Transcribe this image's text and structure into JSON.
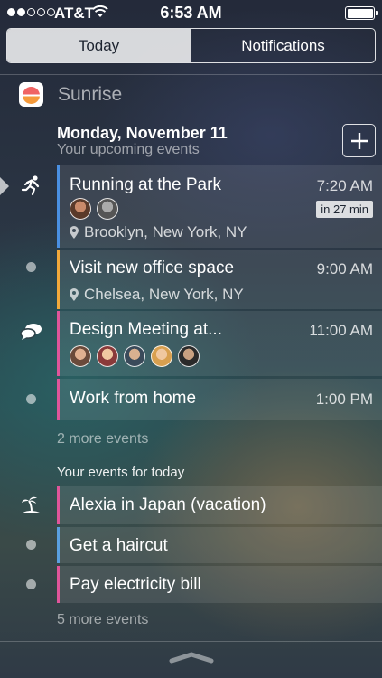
{
  "status_bar": {
    "carrier": "AT&T",
    "time": "6:53 AM",
    "signal_bars": 2
  },
  "tabs": [
    {
      "label": "Today",
      "active": true
    },
    {
      "label": "Notifications",
      "active": false
    }
  ],
  "app": {
    "name": "Sunrise"
  },
  "upcoming": {
    "date_title": "Monday, November 11",
    "subtitle": "Your upcoming events",
    "events": [
      {
        "title": "Running at the Park",
        "time": "7:20 AM",
        "badge": "in 27 min",
        "location": "Brooklyn, New York, NY",
        "color": "#4a90e2",
        "icon": "running-icon",
        "attendees": 2
      },
      {
        "title": "Visit new office space",
        "time": "9:00 AM",
        "location": "Chelsea, New York, NY",
        "color": "#f2a93b",
        "icon": "dot"
      },
      {
        "title": "Design Meeting at...",
        "time": "11:00 AM",
        "color": "#e0559a",
        "icon": "chat-bubbles-icon",
        "attendees": 5
      },
      {
        "title": "Work from home",
        "time": "1:00 PM",
        "color": "#e0559a",
        "icon": "dot"
      }
    ],
    "more_text": "2 more events"
  },
  "today": {
    "section_label": "Your events for today",
    "events": [
      {
        "title": "Alexia in Japan (vacation)",
        "color": "#e0559a",
        "icon": "palm-tree-icon"
      },
      {
        "title": "Get a haircut",
        "color": "#5aa0e0",
        "icon": "dot"
      },
      {
        "title": "Pay electricity bill",
        "color": "#e0559a",
        "icon": "dot"
      }
    ],
    "more_text": "5 more events"
  },
  "colors": {
    "blue": "#4a90e2",
    "orange": "#f2a93b",
    "pink": "#e0559a"
  }
}
